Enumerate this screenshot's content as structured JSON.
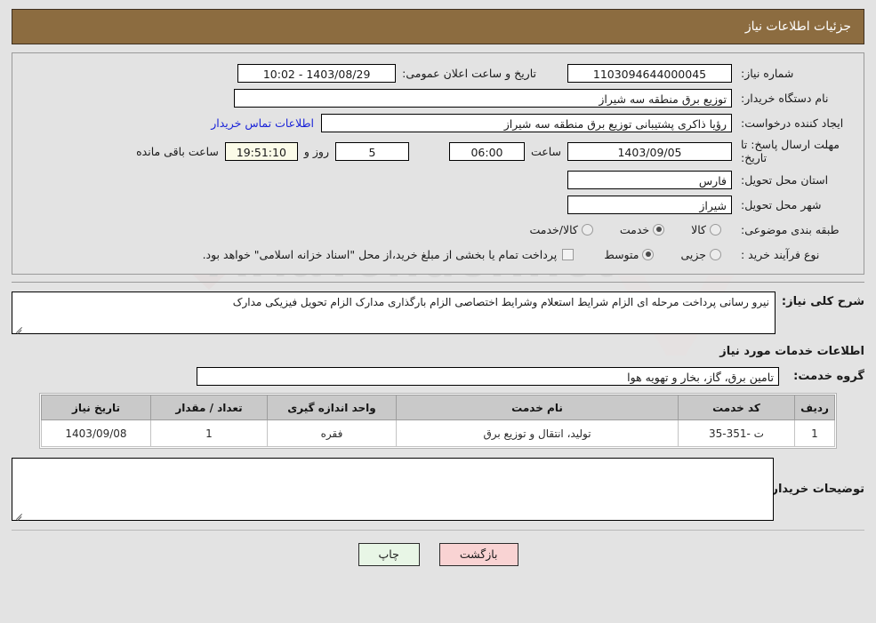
{
  "header": {
    "title": "جزئیات اطلاعات نیاز"
  },
  "form": {
    "need_number": {
      "label": "شماره نیاز:",
      "value": "1103094644000045"
    },
    "announce_datetime": {
      "label": "تاریخ و ساعت اعلان عمومی:",
      "value": "1403/08/29 - 10:02"
    },
    "buyer_org": {
      "label": "نام دستگاه خریدار:",
      "value": "توزیع برق منطقه سه شیراز"
    },
    "requester": {
      "label": "ایجاد کننده درخواست:",
      "value": "رؤیا ذاکری پشتیبانی توزیع برق منطقه سه شیراز"
    },
    "contact_link": "اطلاعات تماس خریدار",
    "deadline": {
      "label": "مهلت ارسال پاسخ: تا تاریخ:",
      "date": "1403/09/05",
      "hour_label": "ساعت",
      "hour": "06:00",
      "days": "5",
      "days_label": "روز و",
      "countdown": "19:51:10",
      "countdown_label": "ساعت باقی مانده"
    },
    "province": {
      "label": "استان محل تحویل:",
      "value": "فارس"
    },
    "city": {
      "label": "شهر محل تحویل:",
      "value": "شیراز"
    },
    "category": {
      "label": "طبقه بندی موضوعی:",
      "options": [
        "کالا",
        "خدمت",
        "کالا/خدمت"
      ],
      "selected": "خدمت"
    },
    "process_type": {
      "label": "نوع فرآیند خرید :",
      "options": [
        "جزیی",
        "متوسط"
      ],
      "selected": "متوسط",
      "checkbox_note": "پرداخت تمام یا بخشی از مبلغ خرید،از محل \"اسناد خزانه اسلامی\" خواهد بود.",
      "checkbox_checked": false
    }
  },
  "description": {
    "label": "شرح کلی نیاز:",
    "value": "نیرو رسانی پرداخت مرحله ای الزام شرایط استعلام وشرایط اختصاصی الزام بارگذاری مدارک الزام تحویل فیزیکی مدارک"
  },
  "services_section": {
    "heading": "اطلاعات خدمات مورد نیاز",
    "group_label": "گروه خدمت:",
    "group_value": "تامین برق، گاز، بخار و تهویه هوا"
  },
  "table": {
    "columns": [
      "ردیف",
      "کد خدمت",
      "نام خدمت",
      "واحد اندازه گیری",
      "تعداد / مقدار",
      "تاریخ نیاز"
    ],
    "rows": [
      [
        "1",
        "ت -351-35",
        "تولید، انتقال و توزیع برق",
        "فقره",
        "1",
        "1403/09/08"
      ]
    ]
  },
  "buyer_notes": {
    "label": "توضیحات خریدار:",
    "value": ""
  },
  "buttons": {
    "print": "چاپ",
    "back": "بازگشت"
  },
  "watermark": {
    "text": "AriaTender.net"
  },
  "colors": {
    "header_bar": "#8c6c40",
    "page_bg": "#e3e3e3",
    "link": "#1a23d8",
    "countdown_bg": "#fbfbe8",
    "print_btn": "#e8f6e6",
    "back_btn": "#f9d3d3",
    "table_header": "#c9c9c9"
  }
}
